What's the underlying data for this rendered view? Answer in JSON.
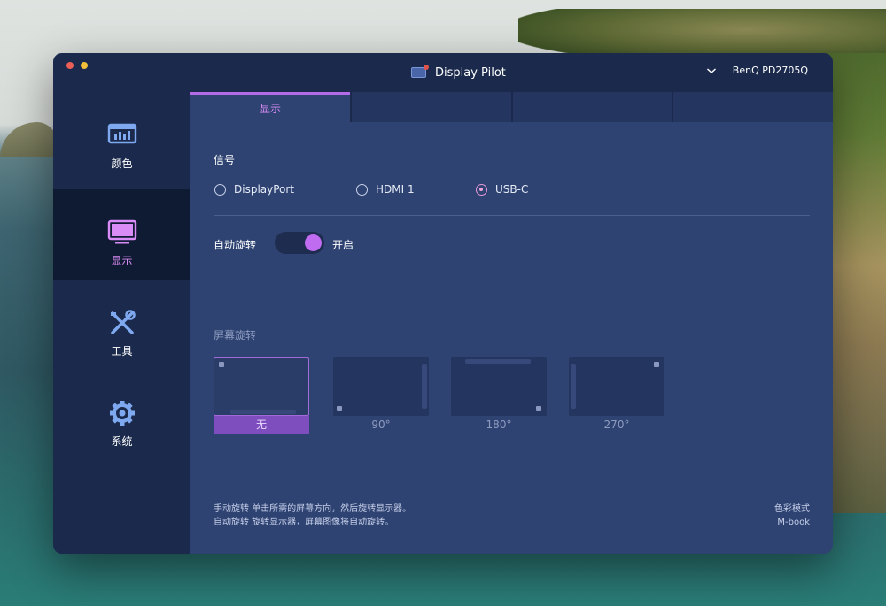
{
  "window": {
    "title": "Display Pilot",
    "monitor": "BenQ PD2705Q"
  },
  "sidebar": {
    "items": [
      {
        "label": "颜色",
        "icon": "color-chart-icon",
        "active": false
      },
      {
        "label": "显示",
        "icon": "monitor-icon",
        "active": true
      },
      {
        "label": "工具",
        "icon": "tools-icon",
        "active": false
      },
      {
        "label": "系统",
        "icon": "gear-icon",
        "active": false
      }
    ]
  },
  "tabs": [
    {
      "label": "显示",
      "active": true
    },
    {
      "label": ""
    },
    {
      "label": ""
    },
    {
      "label": ""
    }
  ],
  "signal": {
    "title": "信号",
    "options": [
      {
        "label": "DisplayPort",
        "selected": false
      },
      {
        "label": "HDMI 1",
        "selected": false
      },
      {
        "label": "USB-C",
        "selected": true
      }
    ]
  },
  "auto_rotate": {
    "label": "自动旋转",
    "state_label": "开启",
    "on": true
  },
  "screen_rotation": {
    "title": "屏幕旋转",
    "options": [
      {
        "label": "无",
        "selected": true
      },
      {
        "label": "90°",
        "selected": false
      },
      {
        "label": "180°",
        "selected": false
      },
      {
        "label": "270°",
        "selected": false
      }
    ]
  },
  "help": {
    "line1": "手动旋转 单击所需的屏幕方向，然后旋转显示器。",
    "line2": "自动旋转 旋转显示器，屏幕图像将自动旋转。"
  },
  "color_mode": {
    "label": "色彩模式",
    "value": "M-book"
  },
  "colors": {
    "accent": "#c06cf0",
    "sidebar_bg": "#1b2a4c",
    "content_bg": "#2e4372",
    "active_sidebar_bg": "#0f1a33"
  }
}
